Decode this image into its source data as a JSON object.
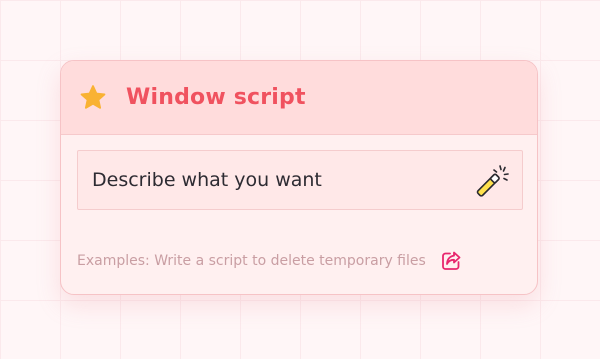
{
  "card": {
    "title": "Window script",
    "header_icon": "star-icon"
  },
  "prompt": {
    "placeholder": "Describe what you want",
    "action_icon": "magic-wand-icon"
  },
  "examples": {
    "text": "Examples: Write a script to delete temporary files",
    "action_icon": "share-external-icon"
  },
  "colors": {
    "accent": "#f0525f",
    "star": "#f9b233",
    "header_bg": "#ffdcdc",
    "card_bg": "#fff0f0",
    "muted_text": "#c99ea3",
    "icon_pink": "#e8266d"
  }
}
